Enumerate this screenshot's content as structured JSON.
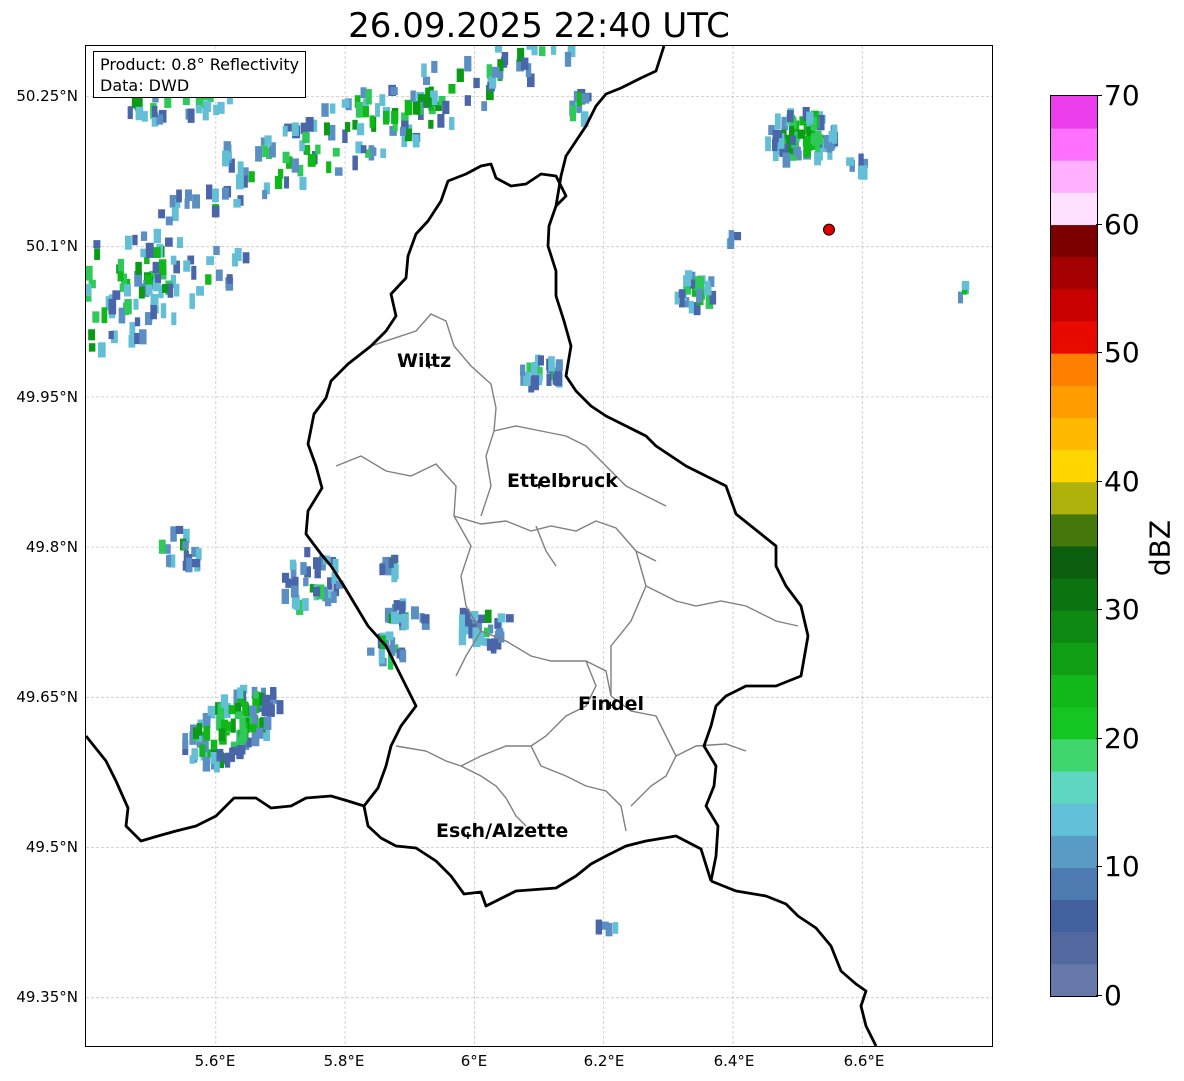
{
  "title": "26.09.2025 22:40 UTC",
  "info": {
    "product": "Product: 0.8° Reflectivity",
    "data": "Data: DWD"
  },
  "axes": {
    "y_ticks": [
      "50.25°N",
      "50.1°N",
      "49.95°N",
      "49.8°N",
      "49.65°N",
      "49.5°N",
      "49.35°N"
    ],
    "x_ticks": [
      "5.6°E",
      "5.8°E",
      "6°E",
      "6.2°E",
      "6.4°E",
      "6.6°E"
    ],
    "grid": true
  },
  "cities": [
    {
      "name": "Wiltz",
      "lon": 5.93,
      "lat": 49.97
    },
    {
      "name": "Ettelbruck",
      "lon": 6.1,
      "lat": 49.85
    },
    {
      "name": "Findel",
      "lon": 6.21,
      "lat": 49.63
    },
    {
      "name": "Esch/Alzette",
      "lon": 5.99,
      "lat": 49.5
    }
  ],
  "radar_site": {
    "lon": 6.55,
    "lat": 50.11,
    "color": "#e00000"
  },
  "colorbar": {
    "label": "dBZ",
    "ticks": [
      "70",
      "60",
      "50",
      "40",
      "30",
      "20",
      "10",
      "0"
    ],
    "min": 0,
    "max": 70,
    "step": 2.5,
    "colors": [
      "#6779a8",
      "#5468a0",
      "#43609f",
      "#4d7ab0",
      "#5a9cc6",
      "#62c0d8",
      "#5fd6c0",
      "#3fd66e",
      "#15c623",
      "#12b81a",
      "#109f14",
      "#0e8a12",
      "#0b7410",
      "#0a5e0d",
      "#45780a",
      "#afb20a",
      "#ffd600",
      "#ffba00",
      "#ff9c00",
      "#ff7f00",
      "#e80a00",
      "#c80000",
      "#a50000",
      "#7d0000",
      "#ffe0ff",
      "#ffb0ff",
      "#ff70ff",
      "#ec3ded"
    ]
  },
  "echo_palette": [
    "#4a66a8",
    "#5b8ec2",
    "#63bfd6",
    "#2fc95a",
    "#10b81a",
    "#0b9a15"
  ]
}
